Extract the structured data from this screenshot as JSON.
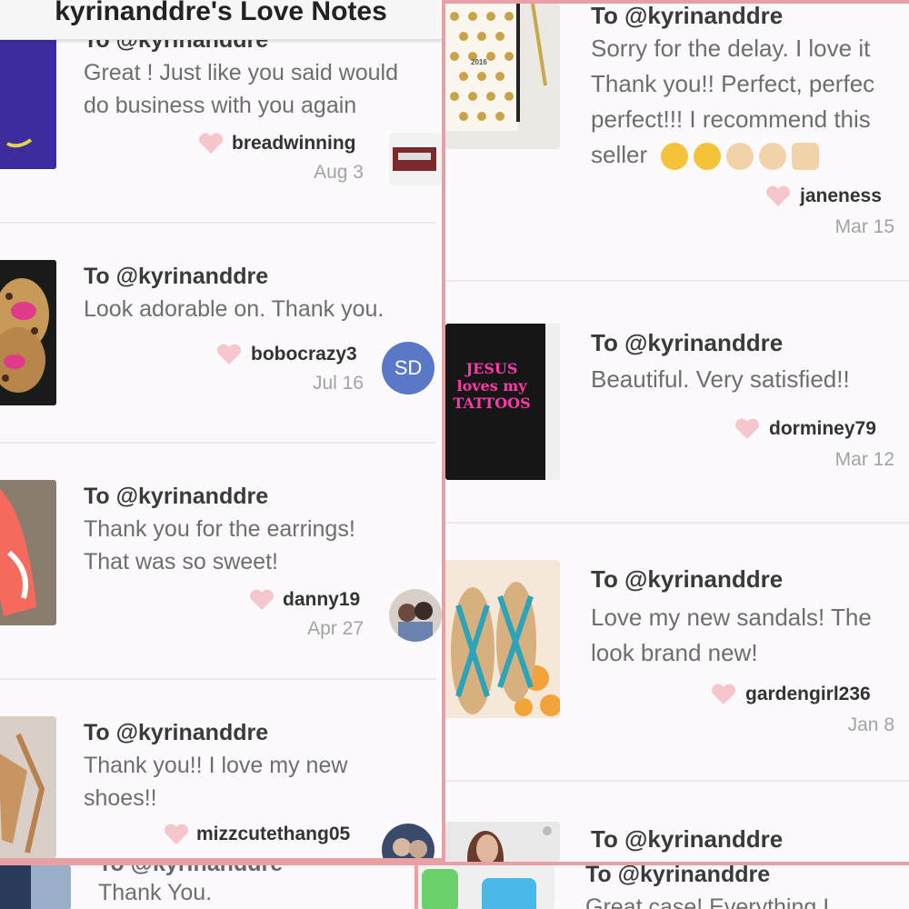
{
  "app": {
    "header_title": "kyrinanddre's Love Notes"
  },
  "colors": {
    "frame": "#e8a0a6",
    "heart": "#f7c6cc",
    "avatar_sd": "#5a78c6",
    "background": "#fcfafc"
  },
  "left_notes": [
    {
      "to": "To @kyrinanddre",
      "line1": "Great ! Just like you said would",
      "line2": "do business with you again",
      "user": "breadwinning",
      "date": "Aug 3"
    },
    {
      "to": "To @kyrinanddre",
      "line1": "Look adorable on. Thank you.",
      "line2": "",
      "user": "bobocrazy3",
      "date": "Jul 16",
      "avatar_initials": "SD"
    },
    {
      "to": "To @kyrinanddre",
      "line1": "Thank you for the earrings!",
      "line2": "That was so sweet!",
      "user": "danny19",
      "date": "Apr 27"
    },
    {
      "to": "To @kyrinanddre",
      "line1": "Thank you!! I love my new",
      "line2": "shoes!!",
      "user": "mizzcutethang05",
      "date": ""
    }
  ],
  "right_notes": [
    {
      "to": "To @kyrinanddre",
      "line1": "Sorry for the delay. I love it",
      "line2": "Thank you!! Perfect, perfec",
      "line3": "perfect!!! I recommend this",
      "line4": "seller",
      "user": "janeness",
      "date": "Mar 15"
    },
    {
      "to": "To @kyrinanddre",
      "line1": "Beautiful. Very satisfied!!",
      "line2": "",
      "user": "dorminey79",
      "date": "Mar 12"
    },
    {
      "to": "To @kyrinanddre",
      "line1": "Love my new sandals! The",
      "line2": "look brand new!",
      "user": "gardengirl236",
      "date": "Jan 8"
    },
    {
      "to": "To @kyrinanddre",
      "line1": "",
      "line2": "",
      "user": "",
      "date": ""
    }
  ],
  "bottom_left": {
    "to": "To @kyrinanddre",
    "msg": "Thank You."
  },
  "bottom_right": {
    "to": "To @kyrinanddre",
    "msg": "Great case! Everything I"
  },
  "thumbs": {
    "shirt_text": "JESUS loves my TATTOOS",
    "planner_year": "2016"
  }
}
